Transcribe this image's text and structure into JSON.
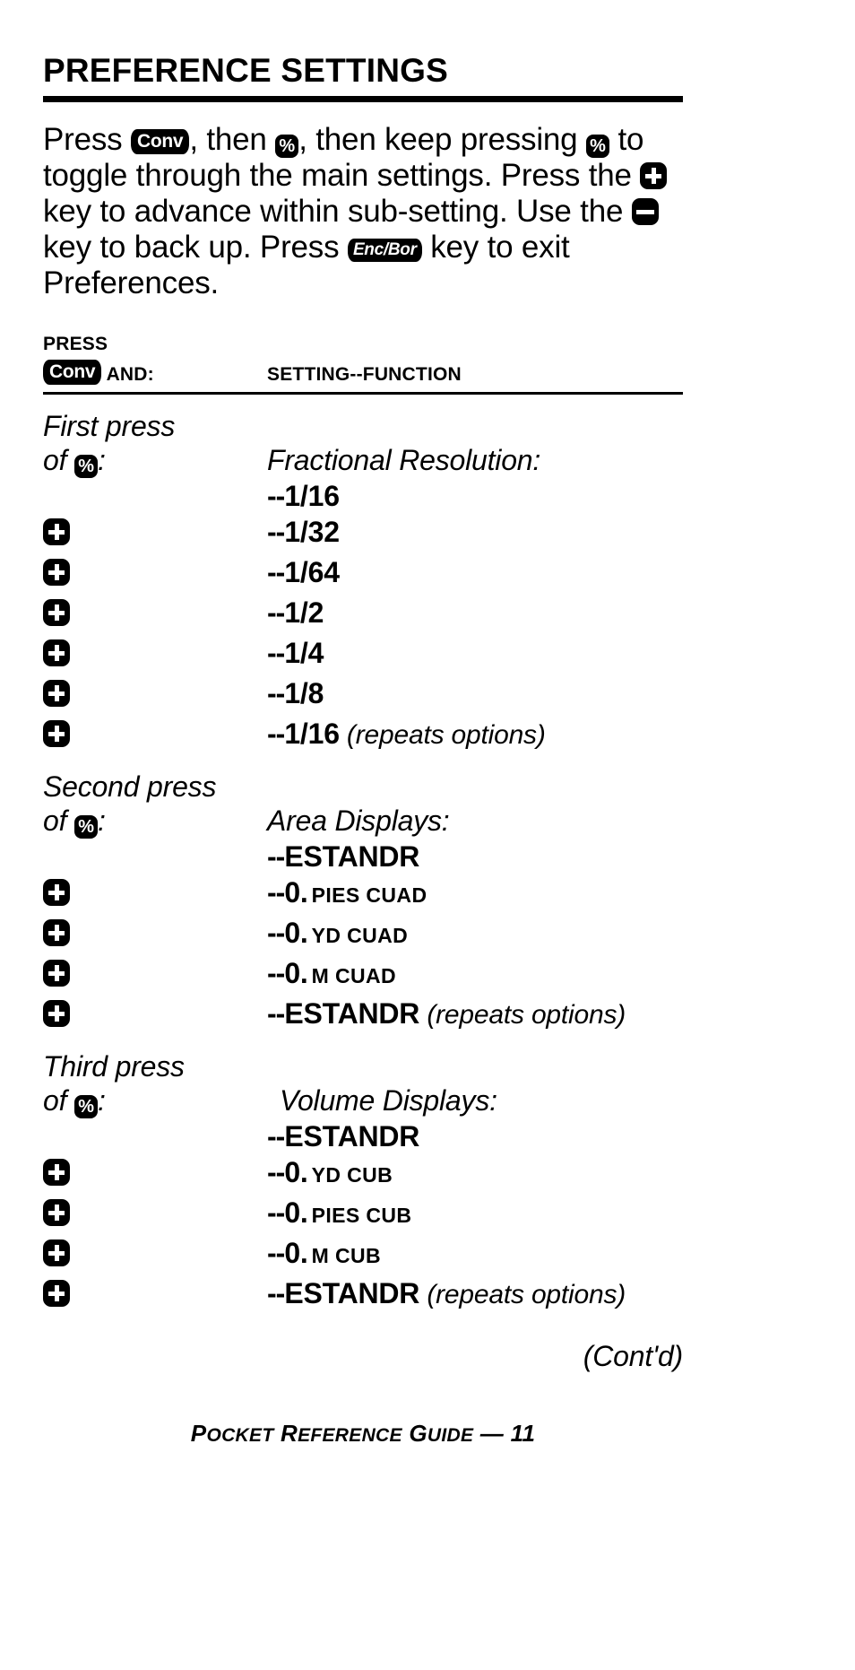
{
  "page": {
    "title": "PREFERENCE SETTINGS",
    "footer": {
      "text_1": "P",
      "text_2": "OCKET",
      "text_3": " R",
      "text_4": "EFERENCE",
      "text_5": " G",
      "text_6": "UIDE",
      "text_7": " — 11",
      "full": "Pocket Reference Guide — 11"
    },
    "continued_label": "(Cont'd)"
  },
  "intro": {
    "t1": "Press ",
    "key_conv": "Conv",
    "t2": ", then ",
    "key_pct": "%",
    "t3": ", then keep pressing ",
    "key_pct2": "%",
    "t4": " to toggle through the main settings. Press the ",
    "key_plus": "+",
    "t5": " key to advance within sub-setting. Use the ",
    "key_minus": "−",
    "t6": " key to back up. Press ",
    "key_encbor": "Enc/Bor",
    "t7": " key to exit Preferences."
  },
  "table": {
    "header": {
      "press_label": "PRESS",
      "col1_key": "Conv",
      "col1_label": " AND:",
      "col2_label": "SETTING--FUNCTION"
    },
    "dash_prefix": "--",
    "plus_key": "+",
    "pct_key": "%",
    "repeats_note": "(repeats options)",
    "sections": [
      {
        "label_line1": "First press",
        "label_line2_pre": "of ",
        "label_line2_post": ":",
        "heading": "Fractional Resolution:",
        "rows": [
          {
            "icon": "none",
            "value": "1/16",
            "unit": "",
            "note": ""
          },
          {
            "icon": "plus",
            "value": "1/32",
            "unit": "",
            "note": ""
          },
          {
            "icon": "plus",
            "value": "1/64",
            "unit": "",
            "note": ""
          },
          {
            "icon": "plus",
            "value": "1/2",
            "unit": "",
            "note": ""
          },
          {
            "icon": "plus",
            "value": "1/4",
            "unit": "",
            "note": ""
          },
          {
            "icon": "plus",
            "value": "1/8",
            "unit": "",
            "note": ""
          },
          {
            "icon": "plus",
            "value": "1/16",
            "unit": "",
            "note": "(repeats options)"
          }
        ]
      },
      {
        "label_line1": "Second press",
        "label_line2_pre": "of ",
        "label_line2_post": ":",
        "heading": "Area Displays:",
        "rows": [
          {
            "icon": "none",
            "value": "ESTANDR",
            "unit": "",
            "note": ""
          },
          {
            "icon": "plus",
            "value": "0.",
            "unit": "PIES CUAD",
            "note": ""
          },
          {
            "icon": "plus",
            "value": "0.",
            "unit": "YD CUAD",
            "note": ""
          },
          {
            "icon": "plus",
            "value": "0.",
            "unit": "M CUAD",
            "note": ""
          },
          {
            "icon": "plus",
            "value": "ESTANDR",
            "unit": "",
            "note": "(repeats options)"
          }
        ]
      },
      {
        "label_line1": "Third press",
        "label_line2_pre": "of ",
        "label_line2_post": ":",
        "heading": "Volume Displays:",
        "rows": [
          {
            "icon": "none",
            "value": "ESTANDR",
            "unit": "",
            "note": ""
          },
          {
            "icon": "plus",
            "value": "0.",
            "unit": "YD CUB",
            "note": ""
          },
          {
            "icon": "plus",
            "value": "0.",
            "unit": "PIES CUB",
            "note": ""
          },
          {
            "icon": "plus",
            "value": "0.",
            "unit": "M CUB",
            "note": ""
          },
          {
            "icon": "plus",
            "value": "ESTANDR",
            "unit": "",
            "note": "(repeats options)"
          }
        ]
      }
    ]
  }
}
